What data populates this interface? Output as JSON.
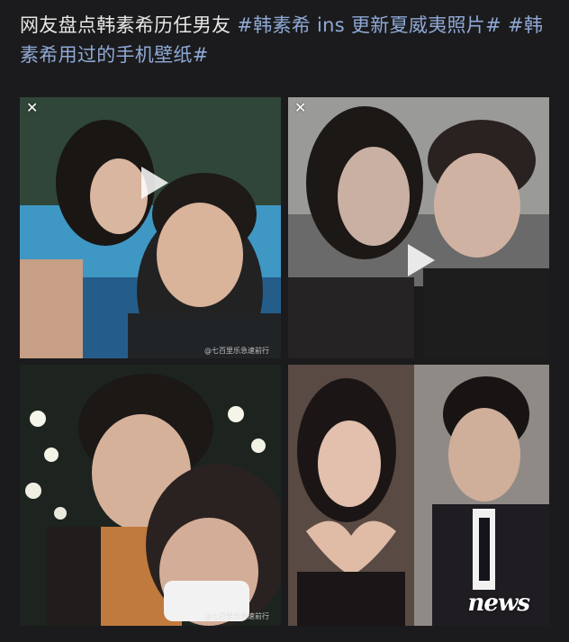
{
  "post": {
    "text_plain": "网友盘点韩素希历任男友 ",
    "hashtag_1": "#韩素希 ins 更新夏威夷照片#",
    "hashtag_2": " #韩素希用过的手机壁纸#"
  },
  "tiles": [
    {
      "has_close": true,
      "has_play": true,
      "watermark": "@七百里乐急速前行"
    },
    {
      "has_close": true,
      "has_play": true,
      "watermark": ""
    },
    {
      "has_close": false,
      "has_play": false,
      "watermark": "@七百里乐急速前行"
    },
    {
      "has_close": false,
      "has_play": false,
      "watermark": ""
    }
  ],
  "icons": {
    "close": "close-icon",
    "play": "play-icon"
  },
  "brand_logo_text": "news",
  "colors": {
    "background": "#1b1b1d",
    "text": "#e7e7e7",
    "hashtag": "#8fa9d6"
  }
}
